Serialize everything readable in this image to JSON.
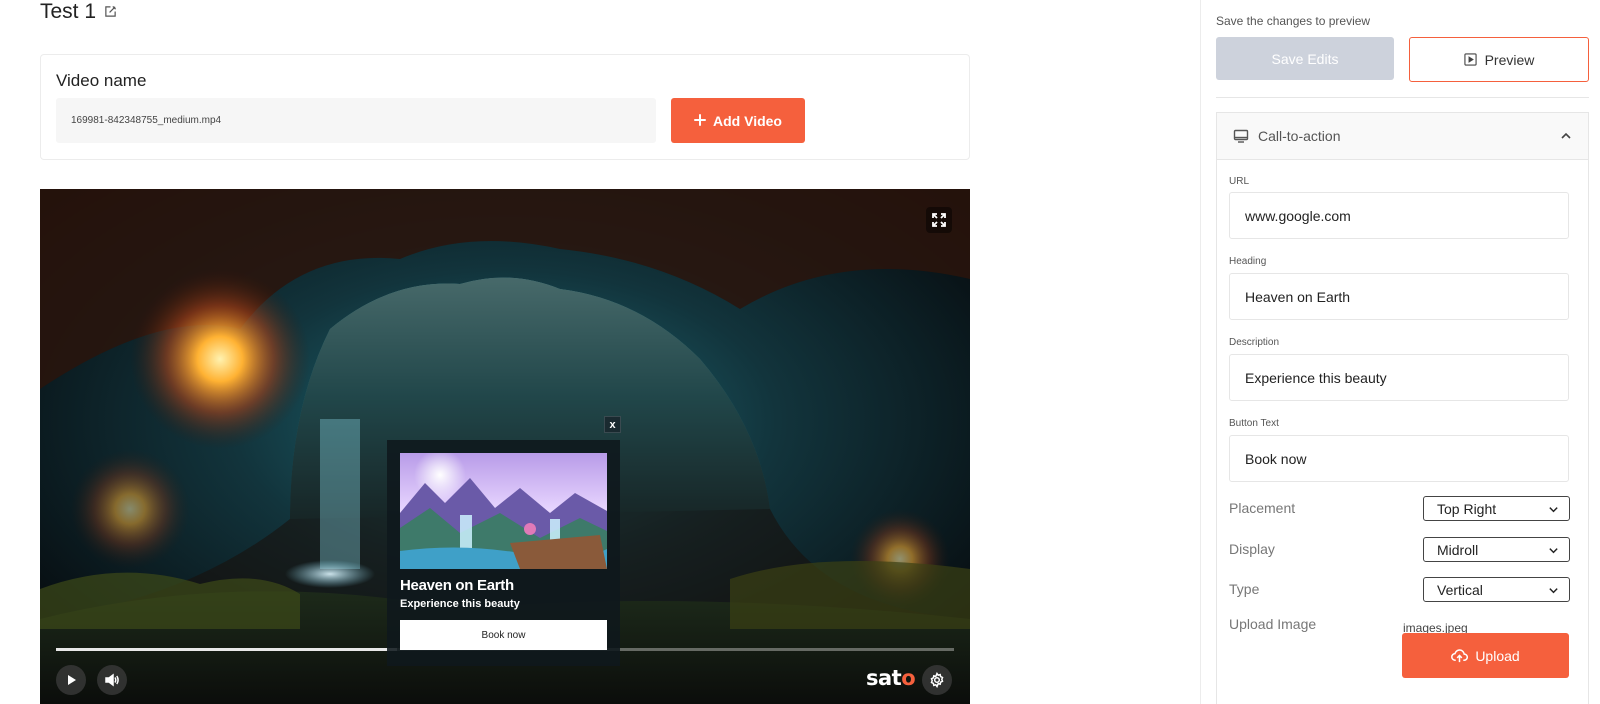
{
  "page": {
    "title": "Test 1"
  },
  "video_card": {
    "label": "Video name",
    "file_value": "169981-842348755_medium.mp4",
    "add_button_label": "Add Video"
  },
  "player": {
    "progress_fraction": 0.38,
    "brand_prefix": "sat",
    "brand_suffix": "o",
    "cta_popup": {
      "close_label": "x",
      "heading": "Heaven on Earth",
      "description": "Experience this beauty",
      "button_label": "Book now"
    }
  },
  "panel": {
    "save_hint": "Save the changes to preview",
    "save_button_label": "Save Edits",
    "preview_button_label": "Preview",
    "cta_section": {
      "title": "Call-to-action",
      "fields": {
        "url": {
          "label": "URL",
          "value": "www.google.com"
        },
        "heading": {
          "label": "Heading",
          "value": "Heaven on Earth"
        },
        "description": {
          "label": "Description",
          "value": "Experience this beauty"
        },
        "button_text": {
          "label": "Button Text",
          "value": "Book now"
        }
      },
      "placement": {
        "label": "Placement",
        "value": "Top Right"
      },
      "display": {
        "label": "Display",
        "value": "Midroll"
      },
      "type": {
        "label": "Type",
        "value": "Vertical"
      },
      "upload": {
        "label": "Upload Image",
        "filename": "images.jpeg",
        "button_label": "Upload"
      }
    }
  },
  "colors": {
    "accent": "#f5603d",
    "save_disabled": "#cdd2dc"
  },
  "icons": {
    "title_edit": "edit-icon",
    "add_video": "plus-icon",
    "fullscreen": "fullscreen-icon",
    "play": "play-icon",
    "volume": "volume-icon",
    "settings": "gear-icon",
    "preview": "play-square-icon",
    "section": "monitor-icon",
    "collapse": "chevron-up-icon",
    "select": "chevron-down-icon",
    "upload": "cloud-upload-icon"
  }
}
